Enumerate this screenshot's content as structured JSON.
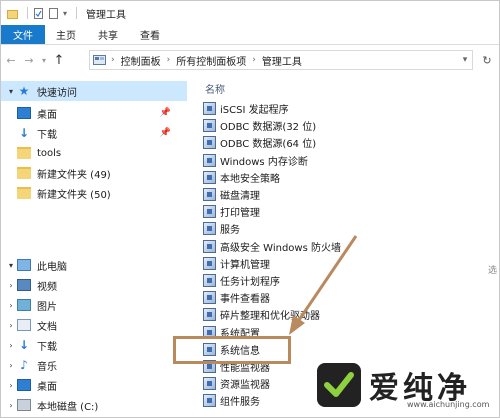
{
  "window": {
    "title": "管理工具"
  },
  "ribbon": {
    "tabs": [
      "文件",
      "主页",
      "共享",
      "查看"
    ]
  },
  "address": {
    "crumbs": [
      "控制面板",
      "所有控制面板项",
      "管理工具"
    ]
  },
  "nav": {
    "quick_access": "快速访问",
    "pinned": [
      {
        "label": "桌面",
        "icon": "desktop-icon",
        "pinned": true
      },
      {
        "label": "下载",
        "icon": "download-icon",
        "pinned": true
      },
      {
        "label": "tools",
        "icon": "folder-icon",
        "pinned": false
      },
      {
        "label": "新建文件夹 (49)",
        "icon": "folder-icon",
        "pinned": false
      },
      {
        "label": "新建文件夹 (50)",
        "icon": "folder-icon",
        "pinned": false
      }
    ],
    "this_pc": "此电脑",
    "pc_items": [
      {
        "label": "视频",
        "icon": "video-icon"
      },
      {
        "label": "图片",
        "icon": "pictures-icon"
      },
      {
        "label": "文档",
        "icon": "documents-icon"
      },
      {
        "label": "下载",
        "icon": "download-icon"
      },
      {
        "label": "音乐",
        "icon": "music-icon"
      },
      {
        "label": "桌面",
        "icon": "desktop-icon"
      },
      {
        "label": "本地磁盘 (C:)",
        "icon": "disk-icon"
      }
    ]
  },
  "content": {
    "column_header": "名称",
    "items": [
      "iSCSI 发起程序",
      "ODBC 数据源(32 位)",
      "ODBC 数据源(64 位)",
      "Windows 内存诊断",
      "本地安全策略",
      "磁盘清理",
      "打印管理",
      "服务",
      "高级安全 Windows 防火墙",
      "计算机管理",
      "任务计划程序",
      "事件查看器",
      "碎片整理和优化驱动器",
      "系统配置",
      "系统信息",
      "性能监视器",
      "资源监视器",
      "组件服务"
    ],
    "side_hint": "选"
  },
  "watermark": {
    "brand": "爱纯净",
    "url": "www.aichunjing.com"
  },
  "colors": {
    "accent": "#1979ca",
    "selection": "#cce8ff",
    "annotation": "#b98a5e"
  }
}
